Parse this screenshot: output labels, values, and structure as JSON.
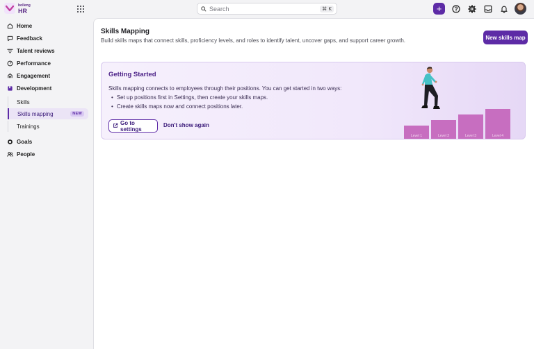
{
  "app": {
    "logo_small": "bolleng",
    "logo_big": "HR"
  },
  "search": {
    "placeholder": "Search",
    "shortcut": "⌘ K"
  },
  "sidebar": {
    "items": [
      {
        "label": "Home",
        "icon": "home-icon"
      },
      {
        "label": "Feedback",
        "icon": "feedback-icon"
      },
      {
        "label": "Talent reviews",
        "icon": "talent-icon"
      },
      {
        "label": "Performance",
        "icon": "performance-icon"
      },
      {
        "label": "Engagement",
        "icon": "engagement-icon"
      },
      {
        "label": "Development",
        "icon": "development-icon"
      },
      {
        "label": "Goals",
        "icon": "goals-icon"
      },
      {
        "label": "People",
        "icon": "people-icon"
      }
    ],
    "sub_items": [
      {
        "label": "Skills"
      },
      {
        "label": "Skills mapping",
        "badge": "NEW",
        "active": true
      },
      {
        "label": "Trainings"
      }
    ]
  },
  "page": {
    "title": "Skills Mapping",
    "subtitle": "Build skills maps that connect skills, proficiency levels, and roles to identify talent, uncover gaps, and support career growth.",
    "new_button": "New skills map"
  },
  "getting_started": {
    "title": "Getting Started",
    "text": "Skills mapping connects to employees through their positions. You can get started in two ways:",
    "steps": [
      "Set up positions first in Settings, then create your skills maps.",
      "Create skills maps now and connect positions later."
    ],
    "settings_button": "Go to settings",
    "dismiss_button": "Don't show again",
    "levels": [
      "Level 1",
      "Level 2",
      "Level 3",
      "Level 4"
    ]
  },
  "colors": {
    "accent": "#5d2ba6",
    "bar": "#c76ec0",
    "panel": "#f1e8fb"
  }
}
